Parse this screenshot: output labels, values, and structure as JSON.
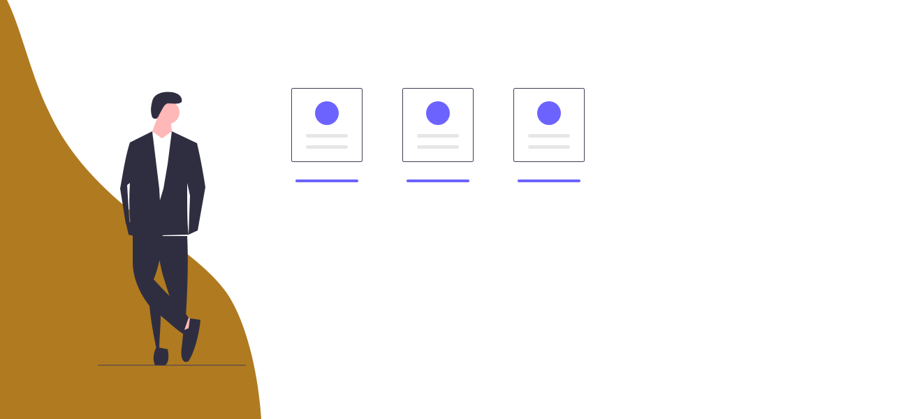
{
  "colors": {
    "background": "#ffffff",
    "accent_shape": "#b07a21",
    "suit": "#2f2e41",
    "skin": "#ffb8b8",
    "shirt": "#ffffff",
    "card_border": "#3f3d56",
    "avatar": "#6c63ff",
    "text_placeholder": "#e6e6e6",
    "underline": "#6c63ff"
  },
  "cards": [
    {
      "avatar_icon": "user-avatar-icon"
    },
    {
      "avatar_icon": "user-avatar-icon"
    },
    {
      "avatar_icon": "user-avatar-icon"
    }
  ],
  "figure": {
    "icon": "standing-man-in-suit"
  }
}
